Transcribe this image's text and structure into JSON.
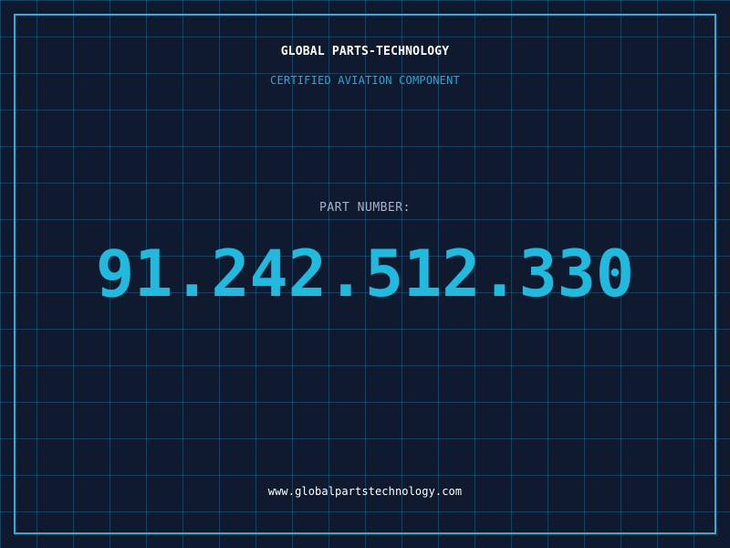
{
  "header": {
    "company_name": "GLOBAL PARTS-TECHNOLOGY",
    "subtitle": "CERTIFIED AVIATION COMPONENT"
  },
  "part": {
    "label": "PART NUMBER:",
    "number": "91.242.512.330"
  },
  "footer": {
    "website": "www.globalpartstechnology.com"
  },
  "colors": {
    "background": "#101a2e",
    "grid": "#2180a8",
    "accent": "#1eb7df",
    "text": "#ffffff",
    "muted_text": "#a8b1c7"
  }
}
